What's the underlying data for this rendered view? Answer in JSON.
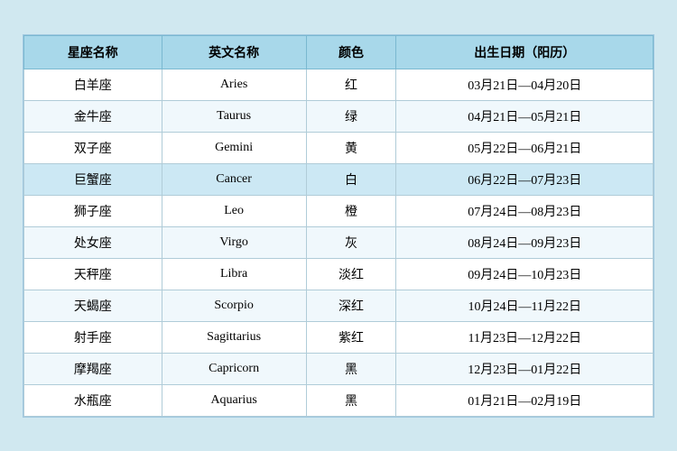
{
  "table": {
    "headers": [
      "星座名称",
      "英文名称",
      "颜色",
      "出生日期（阳历）"
    ],
    "rows": [
      {
        "chinese": "白羊座",
        "english": "Aries",
        "color": "红",
        "dates": "03月21日—04月20日"
      },
      {
        "chinese": "金牛座",
        "english": "Taurus",
        "color": "绿",
        "dates": "04月21日—05月21日"
      },
      {
        "chinese": "双子座",
        "english": "Gemini",
        "color": "黄",
        "dates": "05月22日—06月21日"
      },
      {
        "chinese": "巨蟹座",
        "english": "Cancer",
        "color": "白",
        "dates": "06月22日—07月23日",
        "highlight": true
      },
      {
        "chinese": "狮子座",
        "english": "Leo",
        "color": "橙",
        "dates": "07月24日—08月23日"
      },
      {
        "chinese": "处女座",
        "english": "Virgo",
        "color": "灰",
        "dates": "08月24日—09月23日"
      },
      {
        "chinese": "天秤座",
        "english": "Libra",
        "color": "淡红",
        "dates": "09月24日—10月23日"
      },
      {
        "chinese": "天蝎座",
        "english": "Scorpio",
        "color": "深红",
        "dates": "10月24日—11月22日"
      },
      {
        "chinese": "射手座",
        "english": "Sagittarius",
        "color": "紫红",
        "dates": "11月23日—12月22日"
      },
      {
        "chinese": "摩羯座",
        "english": "Capricorn",
        "color": "黑",
        "dates": "12月23日—01月22日"
      },
      {
        "chinese": "水瓶座",
        "english": "Aquarius",
        "color": "黑",
        "dates": "01月21日—02月19日"
      }
    ]
  }
}
